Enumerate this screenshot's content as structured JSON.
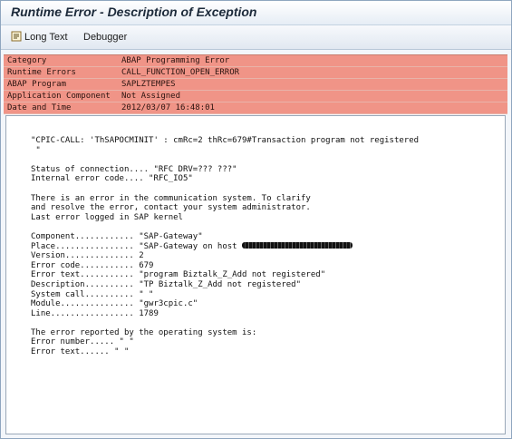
{
  "window": {
    "title": "Runtime Error - Description of Exception"
  },
  "toolbar": {
    "long_text_label": "Long Text",
    "debugger_label": "Debugger",
    "icons": {
      "long_text": "document-lines-icon"
    }
  },
  "header_fields": [
    {
      "key": "Category",
      "value": "ABAP Programming Error"
    },
    {
      "key": "Runtime Errors",
      "value": "CALL_FUNCTION_OPEN_ERROR"
    },
    {
      "key": "ABAP Program",
      "value": "SAPLZTEMPES"
    },
    {
      "key": "Application Component",
      "value": "Not Assigned"
    },
    {
      "key": "Date and Time",
      "value": "2012/03/07 16:48:01"
    }
  ],
  "details": {
    "lines": [
      "\"CPIC-CALL: 'ThSAPOCMINIT' : cmRc=2 thRc=679#Transaction program not registered",
      " \"",
      "",
      "Status of connection.... \"RFC DRV=??? ???\"",
      "Internal error code.... \"RFC_IO5\"",
      "",
      "There is an error in the communication system. To clarify",
      "and resolve the error, contact your system administrator.",
      "Last error logged in SAP kernel",
      "",
      "Component............ \"SAP-Gateway\"",
      "Place................ \"SAP-Gateway on host ",
      "Version.............. 2",
      "Error code........... 679",
      "Error text........... \"program Biztalk_Z_Add not registered\"",
      "Description.......... \"TP Biztalk_Z_Add not registered\"",
      "System call.......... \" \"",
      "Module............... \"gwr3cpic.c\"",
      "Line................. 1789",
      "",
      "The error reported by the operating system is:",
      "Error number..... \" \"",
      "Error text...... \" \""
    ],
    "redacted_line_index": 11
  },
  "colors": {
    "header_background": "#f09487",
    "title_text": "#1c2a3a"
  }
}
